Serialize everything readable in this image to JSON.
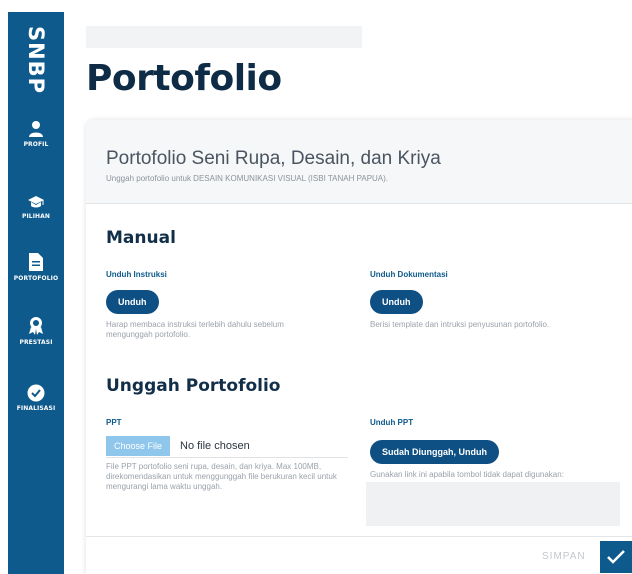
{
  "brand": "SNBP",
  "nav": [
    {
      "label": "PROFIL",
      "icon": "user-icon"
    },
    {
      "label": "PILIHAN",
      "icon": "graduation-cap-icon"
    },
    {
      "label": "PORTOFOLIO",
      "icon": "document-icon"
    },
    {
      "label": "PRESTASI",
      "icon": "award-icon"
    },
    {
      "label": "FINALISASI",
      "icon": "check-circle-icon"
    }
  ],
  "page": {
    "title": "Portofolio"
  },
  "card": {
    "title": "Portofolio Seni Rupa, Desain, dan Kriya",
    "subtitle": "Unggah portofolio untuk DESAIN KOMUNIKASI VISUAL (ISBI TANAH PAPUA)."
  },
  "manual": {
    "title": "Manual",
    "instruksi": {
      "label": "Unduh Instruksi",
      "button": "Unduh",
      "help": "Harap membaca instruksi terlebih dahulu sebelum mengunggah portofolio."
    },
    "dokumentasi": {
      "label": "Unduh Dokumentasi",
      "button": "Unduh",
      "help": "Berisi template dan intruksi penyusunan portofolio."
    }
  },
  "upload": {
    "title": "Unggah Portofolio",
    "ppt_label": "PPT",
    "choose_file": "Choose File",
    "file_status": "No file chosen",
    "ppt_help": "File PPT portofolio seni rupa, desain, dan kriya. Max 100MB, direkomendasikan untuk menggunggah file berukuran kecil untuk mengurangi lama waktu unggah.",
    "download_label": "Unduh PPT",
    "download_button": "Sudah Diunggah, Unduh",
    "download_help": "Gunakan link ini apabila tombol tidak dapat digunakan:"
  },
  "footer": {
    "save_label": "SIMPAN"
  },
  "colors": {
    "primary": "#0e5a8c",
    "button": "#0e4f84",
    "file_button": "#8fc6ec"
  }
}
